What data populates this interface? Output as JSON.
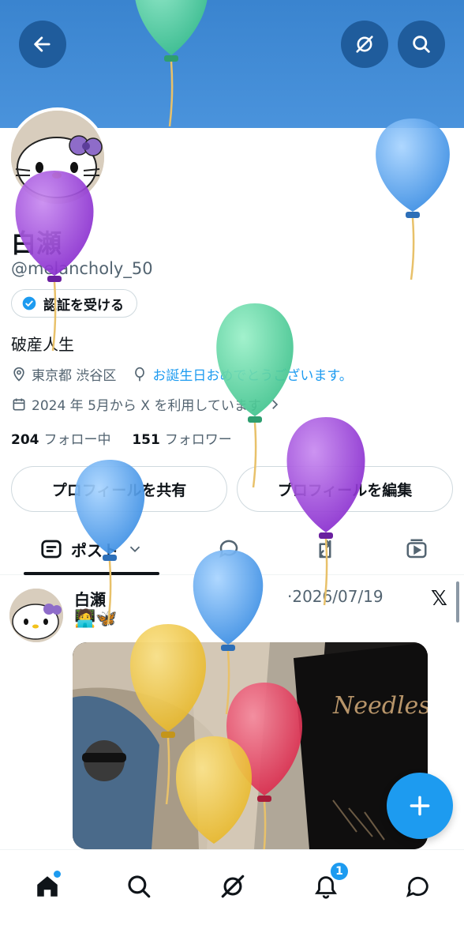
{
  "header": {
    "back_icon": "arrow-left-icon",
    "grok_icon": "grok-icon",
    "search_icon": "search-icon",
    "banner_color": "#3a84cf"
  },
  "profile": {
    "name": "白瀬",
    "handle": "@melancholy_50",
    "verify_label": "認証を受ける",
    "bio": "破産人生",
    "location": "東京都 渋谷区",
    "birthday": "お誕生日おめでとうございます。",
    "joined": "2024 年 5月から X を利用しています",
    "following_count": "204",
    "following_label": "フォロー中",
    "followers_count": "151",
    "followers_label": "フォロワー",
    "share_label": "プロフィールを共有",
    "edit_label": "プロフィールを編集"
  },
  "tabs": {
    "posts_label": "ポスト",
    "items": [
      "posts",
      "replies",
      "reposts",
      "media"
    ]
  },
  "post": {
    "author": "白瀬",
    "date": "·2026/07/19",
    "x_mark": "𝕏",
    "emoji": "🧑‍💻🦋",
    "image_text": "Needles"
  },
  "nav": {
    "notifications_badge": "1",
    "items": [
      "home-icon",
      "search-icon",
      "grok-icon",
      "bell-icon",
      "messages-icon"
    ]
  },
  "colors": {
    "accent": "#1d9bf0",
    "balloon_green": "#5fd3a5",
    "balloon_blue": "#5aaaf0",
    "balloon_purple": "#9b3fd8",
    "balloon_yellow": "#f2c94c",
    "balloon_red": "#e8415e"
  }
}
